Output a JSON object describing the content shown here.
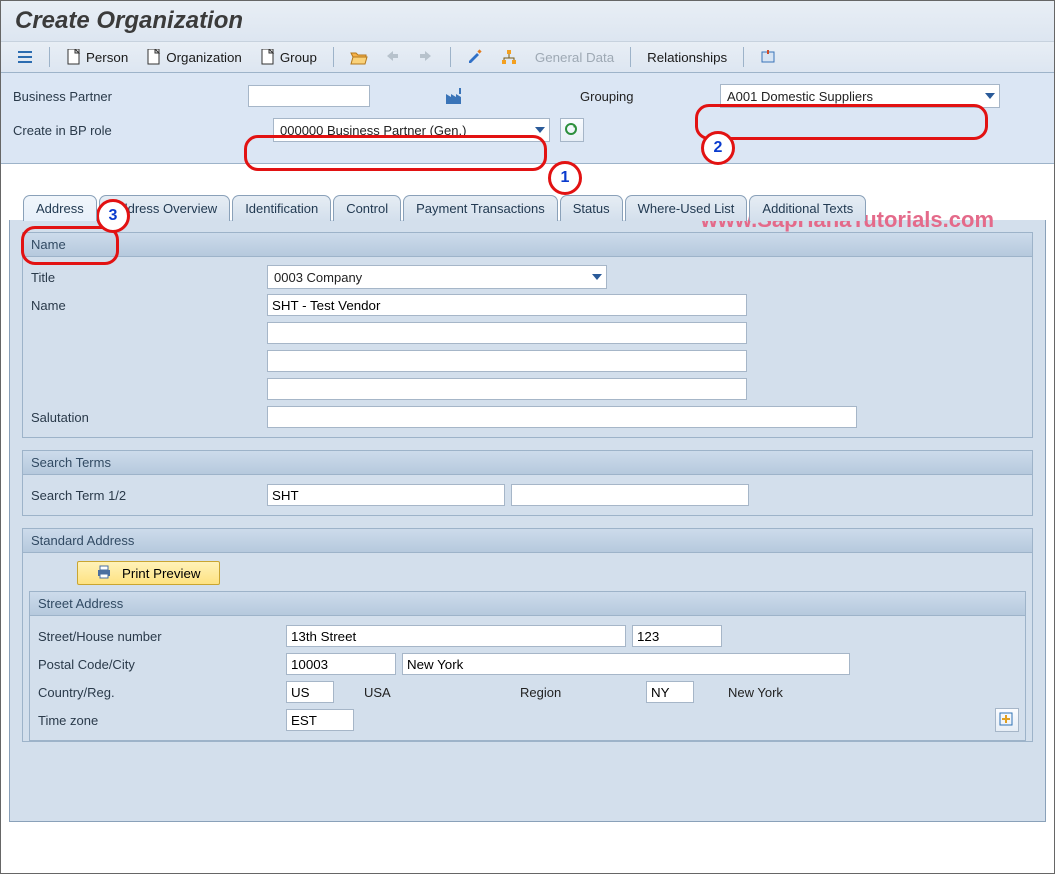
{
  "title": "Create Organization",
  "toolbar": {
    "person": "Person",
    "organization": "Organization",
    "group": "Group",
    "general_data": "General Data",
    "relationships": "Relationships"
  },
  "header": {
    "bp_label": "Business Partner",
    "bp_value": "",
    "grouping_label": "Grouping",
    "grouping_value": "A001 Domestic Suppliers",
    "role_label": "Create in BP role",
    "role_value": "000000 Business Partner (Gen.)"
  },
  "watermark": "www.SapHanaTutorials.com",
  "tabs": [
    "Address",
    "Address Overview",
    "Identification",
    "Control",
    "Payment Transactions",
    "Status",
    "Where-Used List",
    "Additional Texts"
  ],
  "name_group": {
    "title": "Name",
    "title_label": "Title",
    "title_value": "0003 Company",
    "name_label": "Name",
    "name_value": "SHT - Test Vendor",
    "name2_value": "",
    "name3_value": "",
    "name4_value": "",
    "salutation_label": "Salutation",
    "salutation_value": ""
  },
  "search_group": {
    "title": "Search Terms",
    "label": "Search Term 1/2",
    "term1": "SHT",
    "term2": ""
  },
  "std_address": {
    "title": "Standard Address",
    "print_preview": "Print Preview",
    "street_address": "Street Address",
    "street_label": "Street/House number",
    "street": "13th Street",
    "house": "123",
    "postal_label": "Postal Code/City",
    "postal": "10003",
    "city": "New York",
    "country_label": "Country/Reg.",
    "country": "US",
    "country_name": "USA",
    "region_label": "Region",
    "region": "NY",
    "region_name": "New York",
    "tz_label": "Time zone",
    "tz": "EST"
  },
  "annotations": {
    "a1": "1",
    "a2": "2",
    "a3": "3"
  }
}
